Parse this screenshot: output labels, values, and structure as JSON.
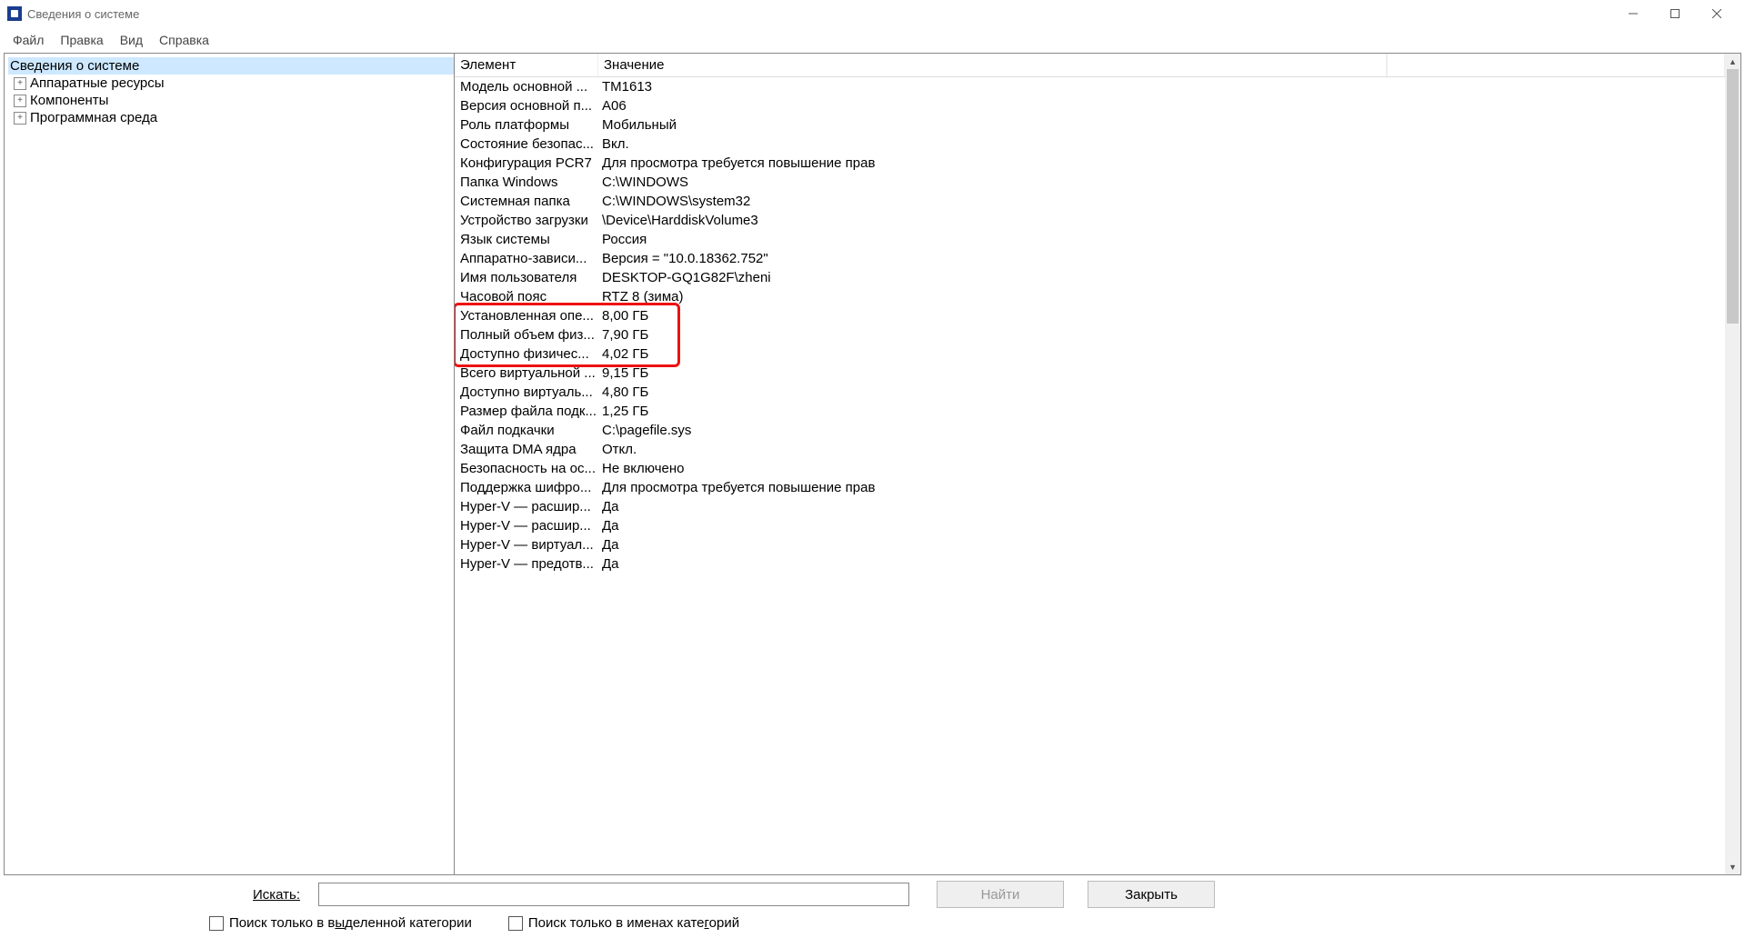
{
  "window": {
    "title": "Сведения о системе"
  },
  "menu": {
    "file": "Файл",
    "edit": "Правка",
    "view": "Вид",
    "help": "Справка"
  },
  "tree": {
    "root": "Сведения о системе",
    "items": [
      {
        "label": "Аппаратные ресурсы"
      },
      {
        "label": "Компоненты"
      },
      {
        "label": "Программная среда"
      }
    ]
  },
  "columns": {
    "element": "Элемент",
    "value": "Значение"
  },
  "rows": [
    {
      "el": "Модель основной ...",
      "val": "TM1613"
    },
    {
      "el": "Версия основной п...",
      "val": "A06"
    },
    {
      "el": "Роль платформы",
      "val": "Мобильный"
    },
    {
      "el": "Состояние безопас...",
      "val": "Вкл."
    },
    {
      "el": "Конфигурация PCR7",
      "val": "Для просмотра требуется повышение прав"
    },
    {
      "el": "Папка Windows",
      "val": "C:\\WINDOWS"
    },
    {
      "el": "Системная папка",
      "val": "C:\\WINDOWS\\system32"
    },
    {
      "el": "Устройство загрузки",
      "val": "\\Device\\HarddiskVolume3"
    },
    {
      "el": "Язык системы",
      "val": "Россия"
    },
    {
      "el": "Аппаратно-зависи...",
      "val": "Версия = \"10.0.18362.752\""
    },
    {
      "el": "Имя пользователя",
      "val": "DESKTOP-GQ1G82F\\zheni"
    },
    {
      "el": "Часовой пояс",
      "val": "RTZ 8 (зима)"
    },
    {
      "el": "Установленная опе...",
      "val": "8,00 ГБ"
    },
    {
      "el": "Полный объем физ...",
      "val": "7,90 ГБ"
    },
    {
      "el": "Доступно физичес...",
      "val": "4,02 ГБ"
    },
    {
      "el": "Всего виртуальной ...",
      "val": "9,15 ГБ"
    },
    {
      "el": "Доступно виртуаль...",
      "val": "4,80 ГБ"
    },
    {
      "el": "Размер файла подк...",
      "val": "1,25 ГБ"
    },
    {
      "el": "Файл подкачки",
      "val": "C:\\pagefile.sys"
    },
    {
      "el": "Защита DMA ядра",
      "val": "Откл."
    },
    {
      "el": "Безопасность на ос...",
      "val": "Не включено"
    },
    {
      "el": "Поддержка шифро...",
      "val": "Для просмотра требуется повышение прав"
    },
    {
      "el": "Hyper-V — расшир...",
      "val": "Да"
    },
    {
      "el": "Hyper-V — расшир...",
      "val": "Да"
    },
    {
      "el": "Hyper-V — виртуал...",
      "val": "Да"
    },
    {
      "el": "Hyper-V — предотв...",
      "val": "Да"
    }
  ],
  "search": {
    "label": "Искать:",
    "find": "Найти",
    "close": "Закрыть",
    "chk1_pre": "Поиск только в в",
    "chk1_u": "ы",
    "chk1_post": "деленной категории",
    "chk2_pre": "Поиск только в именах кате",
    "chk2_u": "г",
    "chk2_post": "орий"
  }
}
